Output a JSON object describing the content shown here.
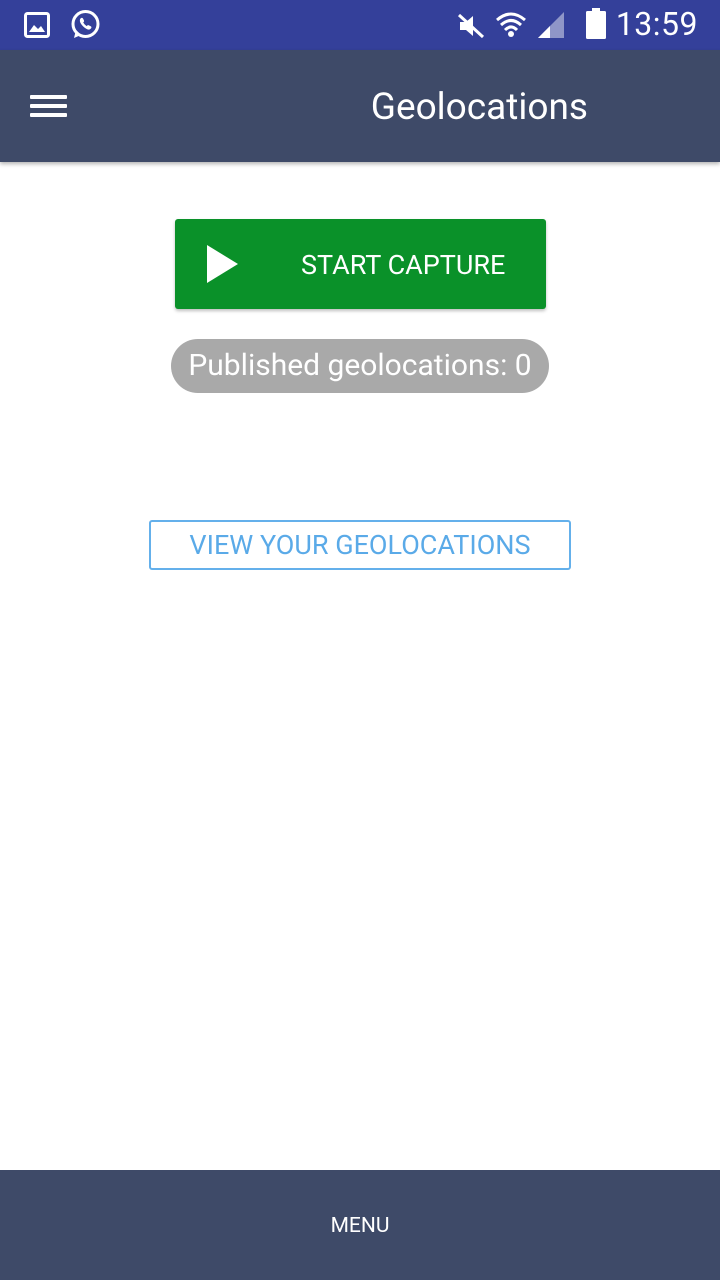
{
  "status_bar": {
    "time": "13:59",
    "left_icons": [
      "image-notification-icon",
      "whatsapp-icon"
    ],
    "right_icons": [
      "mute-icon",
      "wifi-icon",
      "signal-icon",
      "battery-icon"
    ],
    "color": "#34409a"
  },
  "app_bar": {
    "title": "Geolocations",
    "menu_icon": "hamburger-menu-icon",
    "color": "#3e4a68"
  },
  "main": {
    "start_button": {
      "label": "START CAPTURE",
      "icon": "play-icon",
      "color": "#0a9129"
    },
    "published_count": {
      "text": "Published geolocations: 0",
      "color": "#a9a9a9"
    },
    "view_button": {
      "label": "VIEW YOUR GEOLOCATIONS",
      "color": "#5aaae8"
    }
  },
  "bottom_bar": {
    "label": "MENU",
    "color": "#3e4a68"
  }
}
